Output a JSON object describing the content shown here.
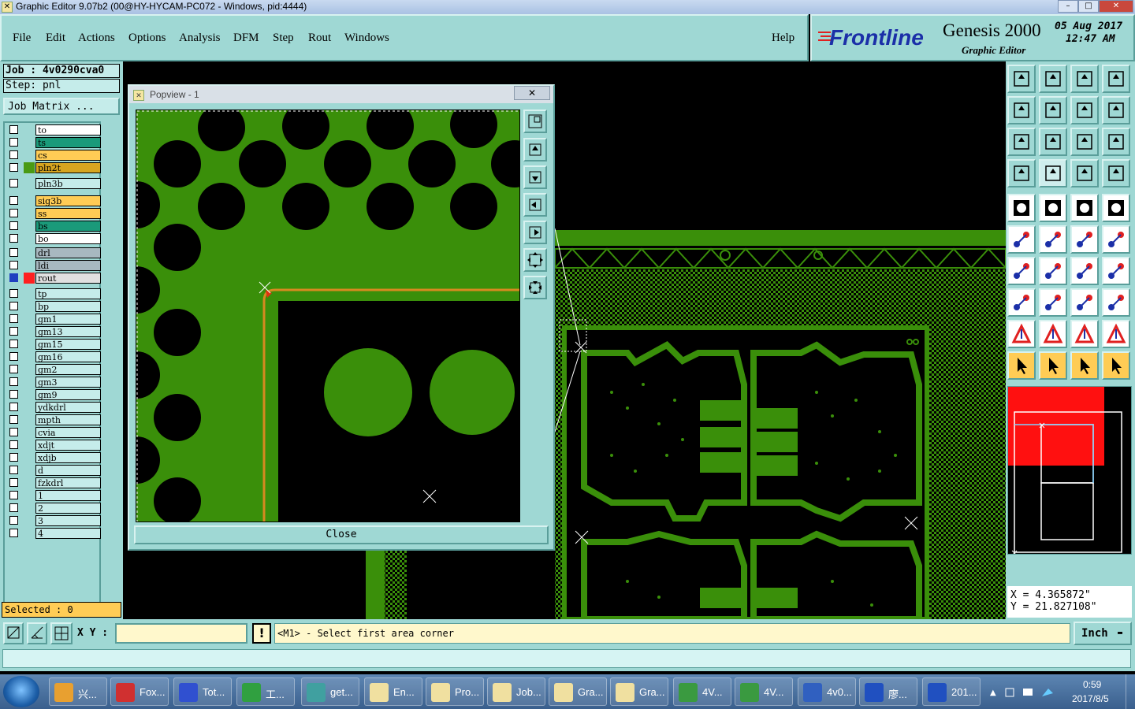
{
  "window": {
    "title": "Graphic Editor 9.07b2 (00@HY-HYCAM-PC072 - Windows, pid:4444)",
    "controls": [
      "–",
      "□",
      "✕"
    ]
  },
  "menu": {
    "items": [
      "File",
      "Edit",
      "Actions",
      "Options",
      "Analysis",
      "DFM",
      "Step",
      "Rout",
      "Windows"
    ],
    "help": "Help"
  },
  "brand": {
    "logo": "Frontline",
    "product": "Genesis 2000",
    "subtitle": "Graphic Editor",
    "date": "05 Aug 2017",
    "time": "12:47 AM"
  },
  "job": {
    "job_label": "Job : 4v0290cva0",
    "step_label": "Step: pnl",
    "matrix_button": "Job Matrix ..."
  },
  "layers": [
    {
      "name": "to",
      "color": "#ffffff"
    },
    {
      "name": "ts",
      "color": "#1a9a7a"
    },
    {
      "name": "cs",
      "color": "#ffcc55"
    },
    {
      "name": "pln2t",
      "color": "#d7a520",
      "swatch": "#4a9a14"
    },
    {
      "name": "pln3b",
      "color": "#c5ecea"
    },
    {
      "name": "sig3b",
      "color": "#ffcc55"
    },
    {
      "name": "ss",
      "color": "#ffcc55"
    },
    {
      "name": "bs",
      "color": "#1a9a7a"
    },
    {
      "name": "bo",
      "color": "#ffffff"
    },
    {
      "name": "drl",
      "color": "#a8b8c0"
    },
    {
      "name": "ldi",
      "color": "#a8b8c0"
    },
    {
      "name": "rout",
      "color": "#e0e0e0",
      "swatch": "#ff2020",
      "active": true
    },
    {
      "name": "tp",
      "color": "#c5ecea"
    },
    {
      "name": "bp",
      "color": "#c5ecea"
    },
    {
      "name": "gm1",
      "color": "#c5ecea"
    },
    {
      "name": "gm13",
      "color": "#c5ecea"
    },
    {
      "name": "gm15",
      "color": "#c5ecea"
    },
    {
      "name": "gm16",
      "color": "#c5ecea"
    },
    {
      "name": "gm2",
      "color": "#c5ecea"
    },
    {
      "name": "gm3",
      "color": "#c5ecea"
    },
    {
      "name": "gm9",
      "color": "#c5ecea"
    },
    {
      "name": "ydkdrl",
      "color": "#c5ecea"
    },
    {
      "name": "mpth",
      "color": "#c5ecea"
    },
    {
      "name": "cvia",
      "color": "#c5ecea"
    },
    {
      "name": "xdjt",
      "color": "#c5ecea"
    },
    {
      "name": "xdjb",
      "color": "#c5ecea"
    },
    {
      "name": "d",
      "color": "#c5ecea"
    },
    {
      "name": "fzkdrl",
      "color": "#c5ecea"
    },
    {
      "name": "1",
      "color": "#c5ecea"
    },
    {
      "name": "2",
      "color": "#c5ecea"
    },
    {
      "name": "3",
      "color": "#c5ecea"
    },
    {
      "name": "4",
      "color": "#c5ecea"
    }
  ],
  "selected": "Selected : 0",
  "popview": {
    "title": "Popview - 1",
    "close_label": "Close"
  },
  "coords": {
    "x": "X = 4.365872\"",
    "y": "Y = 21.827108\""
  },
  "command": {
    "xy_label": "X Y :",
    "xy_value": "",
    "prompt": "<M1> - Select first area corner",
    "units": "Inch"
  },
  "taskbar": {
    "items": [
      "兴...",
      "Fox...",
      "Tot...",
      "工...",
      "get...",
      "En...",
      "Pro...",
      "Job...",
      "Gra...",
      "Gra...",
      "4V...",
      "4V...",
      "4v0...",
      "廖...",
      "201..."
    ],
    "clock_time": "0:59",
    "clock_date": "2017/8/5"
  },
  "colors": {
    "panel": "#9fd8d4",
    "copper": "#3a8f0a",
    "background": "#000000",
    "highlight": "#ffcc55"
  }
}
